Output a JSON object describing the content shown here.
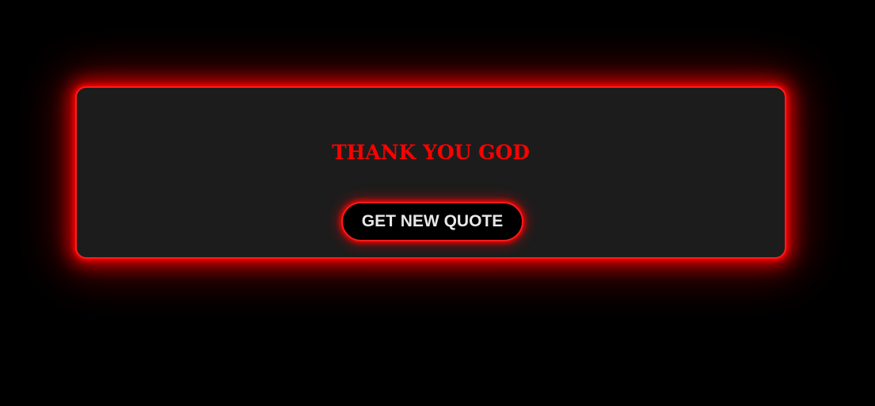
{
  "quote": {
    "text": "THANK YOU GOD"
  },
  "actions": {
    "new_quote_label": "GET NEW QUOTE"
  },
  "colors": {
    "background": "#000000",
    "card": "#1c1c1c",
    "accent": "#ff0000",
    "button_text": "#e8e8e8"
  }
}
